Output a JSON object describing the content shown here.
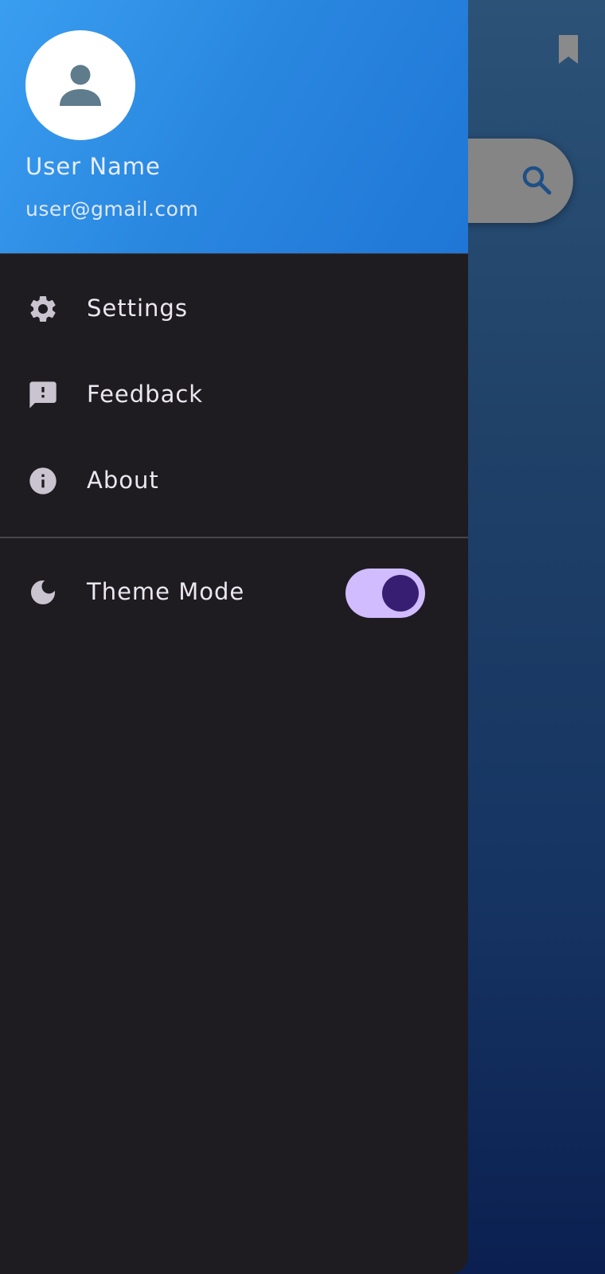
{
  "header": {
    "user_name": "User Name",
    "user_email": "user@gmail.com",
    "avatar_icon": "person-icon"
  },
  "menu": {
    "items": [
      {
        "label": "Settings",
        "icon": "gear-icon"
      },
      {
        "label": "Feedback",
        "icon": "feedback-icon"
      },
      {
        "label": "About",
        "icon": "info-icon"
      }
    ]
  },
  "theme": {
    "label": "Theme Mode",
    "icon": "moon-icon",
    "toggle_on": true
  },
  "background_app": {
    "bookmark_icon": "bookmark-icon",
    "search_icon": "search-icon"
  },
  "colors": {
    "header_gradient_start": "#3a9ef0",
    "header_gradient_end": "#1f76d6",
    "drawer_bg": "#1e1c21",
    "toggle_track": "#d0bcff",
    "toggle_thumb": "#381e72",
    "icon_color": "#cac4d0"
  }
}
